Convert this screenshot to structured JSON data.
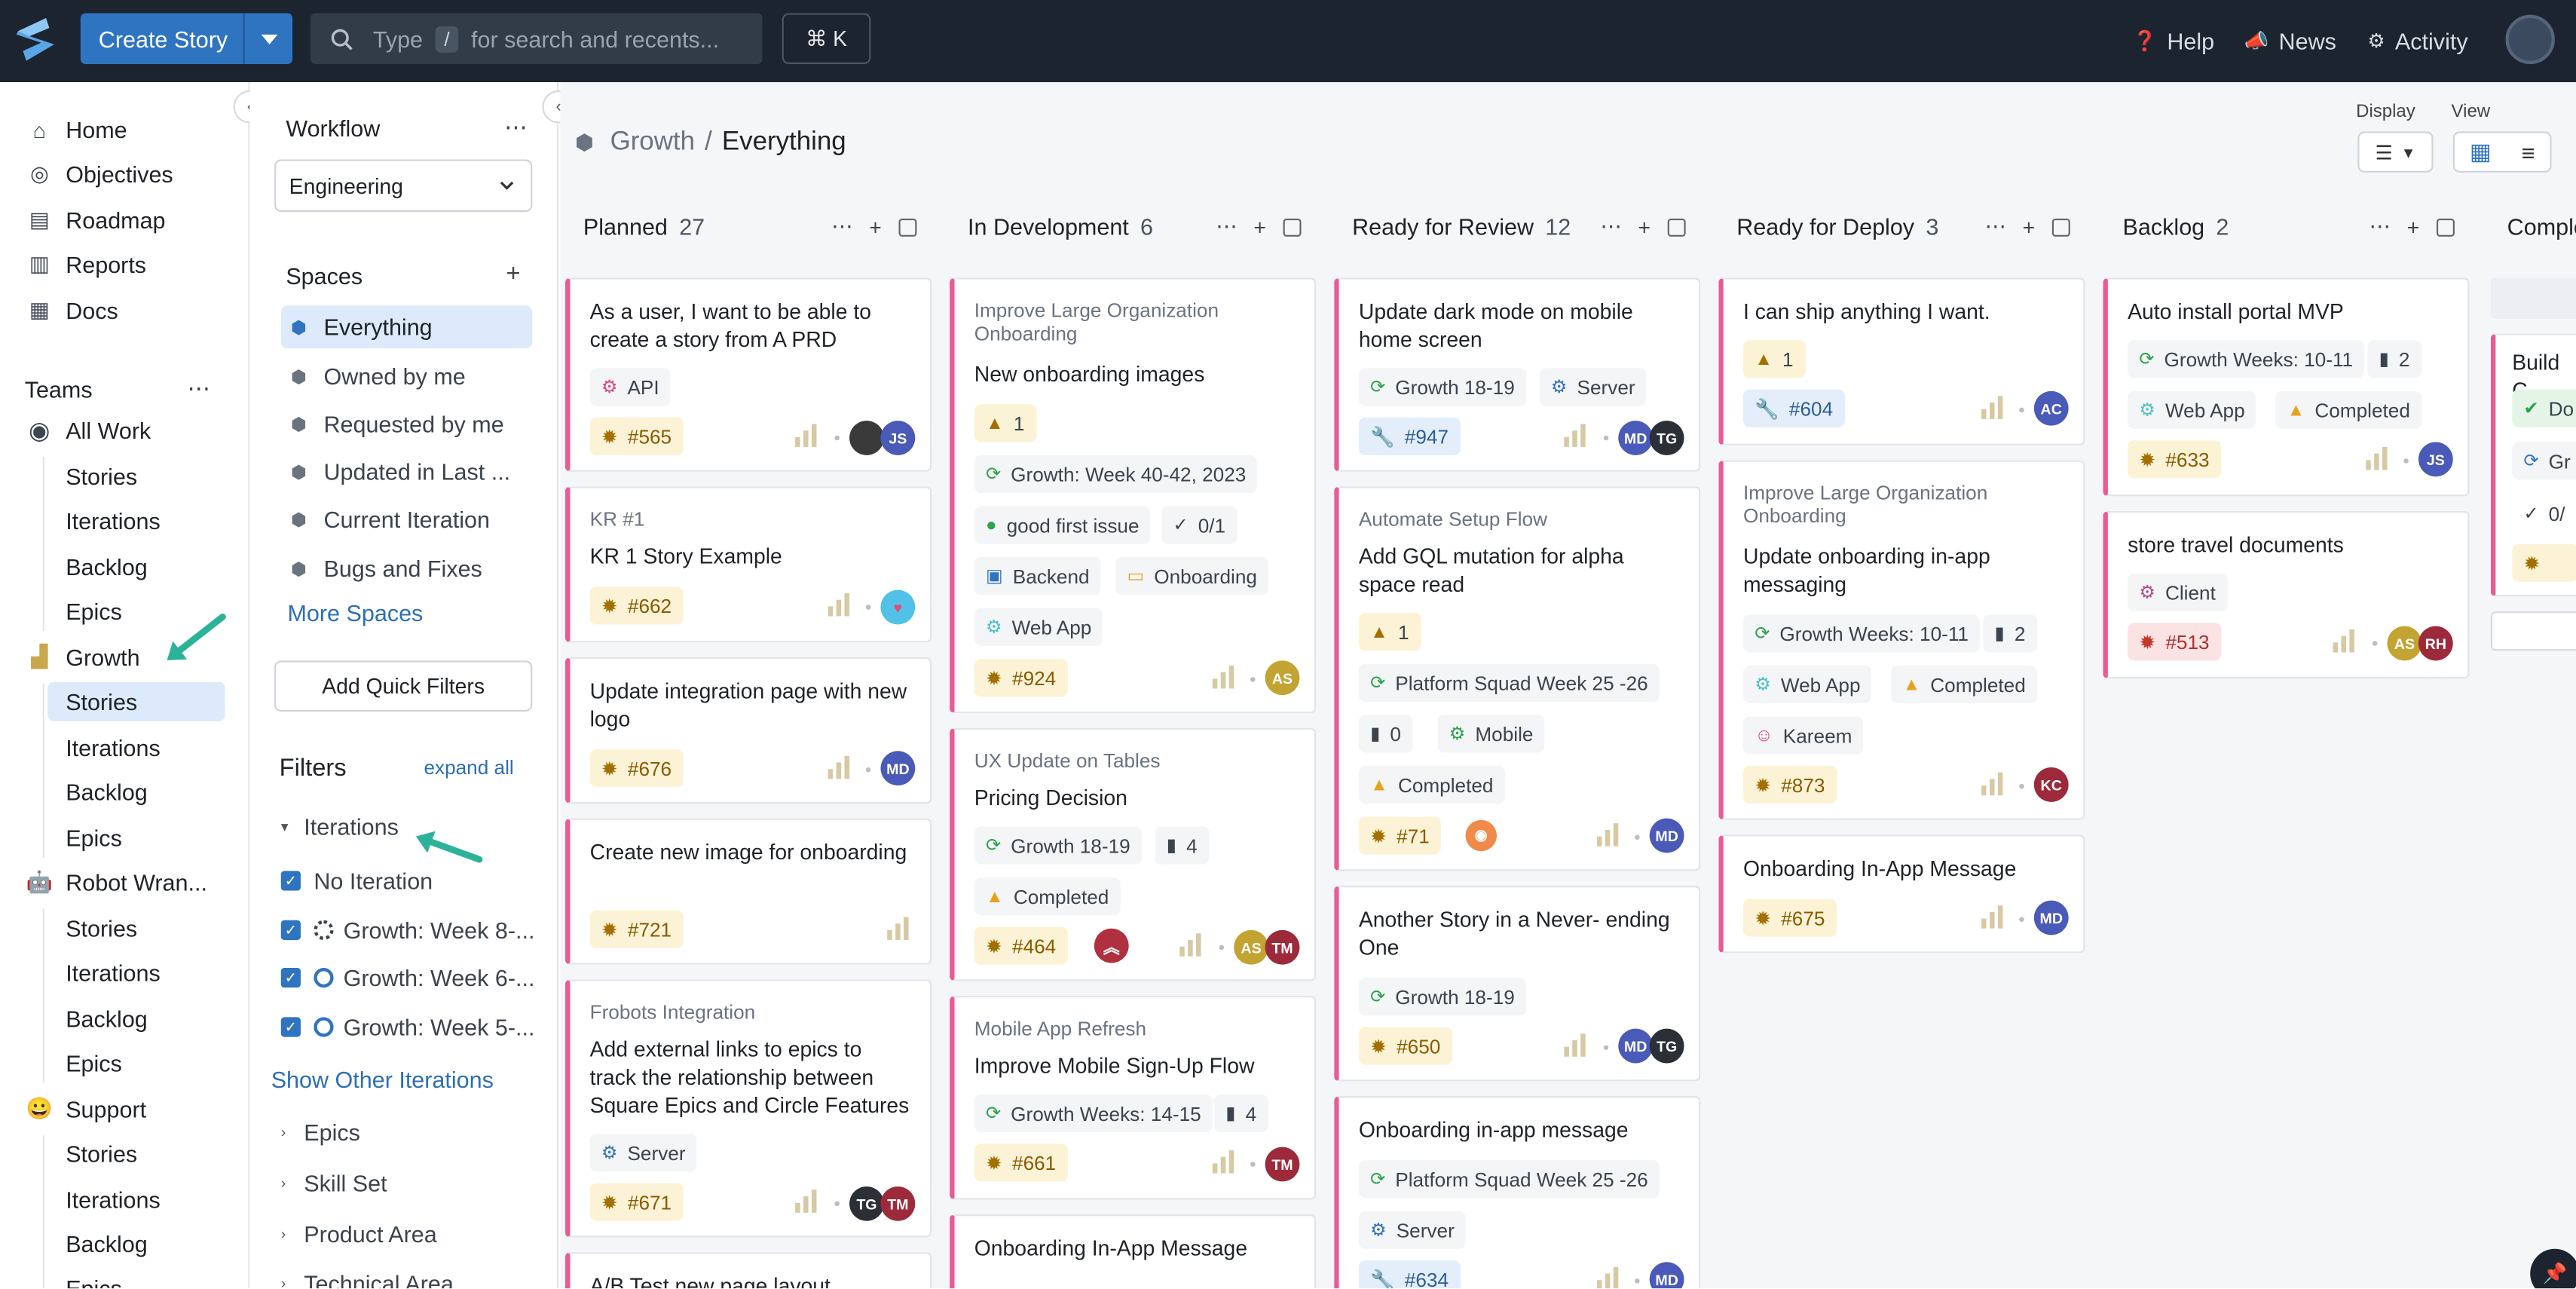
{
  "topbar": {
    "create_story": "Create Story",
    "search_placeholder": "Type",
    "search_key": "/",
    "search_suffix": "for search and recents...",
    "cmdk": "⌘ K",
    "help": "Help",
    "news": "News",
    "activity": "Activity"
  },
  "nav": {
    "home": "Home",
    "objectives": "Objectives",
    "roadmap": "Roadmap",
    "reports": "Reports",
    "docs": "Docs",
    "teams": "Teams",
    "all_work": "All Work",
    "stories": "Stories",
    "iterations": "Iterations",
    "backlog": "Backlog",
    "epics": "Epics",
    "growth": "Growth",
    "robot": "Robot Wran...",
    "support": "Support"
  },
  "workflow": {
    "title": "Workflow",
    "value": "Engineering"
  },
  "spaces": {
    "title": "Spaces",
    "items": [
      "Everything",
      "Owned by me",
      "Requested by me",
      "Updated in Last ...",
      "Current Iteration",
      "Bugs and Fixes"
    ],
    "more": "More Spaces",
    "quick": "Add Quick Filters"
  },
  "filters": {
    "title": "Filters",
    "expand": "expand all",
    "iterations": "Iterations",
    "opts": [
      "No Iteration",
      "Growth: Week 8-...",
      "Growth: Week 6-...",
      "Growth: Week 5-..."
    ],
    "show_other": "Show Other Iterations",
    "groups": [
      "Epics",
      "Skill Set",
      "Product Area",
      "Technical Area"
    ]
  },
  "breadcrumb": {
    "parent": "Growth",
    "sep": "/",
    "current": "Everything"
  },
  "display": {
    "display": "Display",
    "view": "View"
  },
  "columns": [
    {
      "name": "Planned",
      "count": "27"
    },
    {
      "name": "In Development",
      "count": "6"
    },
    {
      "name": "Ready for Review",
      "count": "12"
    },
    {
      "name": "Ready for Deploy",
      "count": "3"
    },
    {
      "name": "Backlog",
      "count": "2"
    },
    {
      "name": "Comple"
    }
  ],
  "cards": {
    "c1": {
      "title": "As a user, I want to be able to create a story from A PRD",
      "tag": "API",
      "num": "#565",
      "av2": "JS"
    },
    "c2": {
      "epic": "KR #1",
      "title": "KR 1 Story Example",
      "num": "#662"
    },
    "c3": {
      "title": "Update integration page with new logo",
      "num": "#676",
      "av": "MD"
    },
    "c4": {
      "title": "Create new image for onboarding",
      "num": "#721"
    },
    "c5": {
      "epic": "Frobots Integration",
      "title": "Add external links to epics to track the relationship between Square Epics and Circle Features",
      "tag": "Server",
      "num": "#671",
      "av1": "TG",
      "av2": "TM"
    },
    "c6": {
      "title": "A/B Test new page layout"
    },
    "d1": {
      "epic": "Improve Large Organization Onboarding",
      "title": "New onboarding images",
      "prio": "1",
      "iter": "Growth: Week 40-42, 2023",
      "label": "good first issue",
      "check": "0/1",
      "t1": "Backend",
      "t2": "Onboarding",
      "t3": "Web App",
      "num": "#924",
      "av": "AS"
    },
    "d2": {
      "epic": "UX Update on Tables",
      "title": "Pricing Decision",
      "iter": "Growth 18-19",
      "est": "4",
      "state": "Completed",
      "num": "#464",
      "av1": "AS",
      "av2": "TM"
    },
    "d3": {
      "epic": "Mobile App Refresh",
      "title": "Improve Mobile Sign-Up Flow",
      "iter": "Growth Weeks: 14-15",
      "est": "4",
      "num": "#661",
      "av": "TM"
    },
    "d4": {
      "title": "Onboarding In-App Message"
    },
    "r1": {
      "title": "Update dark mode on mobile home screen",
      "iter": "Growth 18-19",
      "tag": "Server",
      "num": "#947",
      "av1": "MD",
      "av2": "TG"
    },
    "r2": {
      "epic": "Automate Setup Flow",
      "title": "Add GQL mutation for alpha space read",
      "prio": "1",
      "iter": "Platform Squad Week 25 -26",
      "est": "0",
      "tag": "Mobile",
      "state": "Completed",
      "num": "#71",
      "av": "MD"
    },
    "r3": {
      "title": "Another Story in a Never- ending One",
      "iter": "Growth 18-19",
      "num": "#650",
      "av1": "MD",
      "av2": "TG"
    },
    "r4": {
      "title": "Onboarding in-app message",
      "iter": "Platform Squad Week 25 -26",
      "tag": "Server",
      "num": "#634",
      "av": "MD"
    },
    "p1": {
      "title": "I can ship anything I want.",
      "prio": "1",
      "num": "#604",
      "av": "AC"
    },
    "p2": {
      "epic": "Improve Large Organization Onboarding",
      "title": "Update onboarding in-app messaging",
      "iter": "Growth Weeks: 10-11",
      "est": "2",
      "t1": "Web App",
      "state": "Completed",
      "owner": "Kareem",
      "num": "#873",
      "av": "KC"
    },
    "p3": {
      "title": "Onboarding In-App Message",
      "num": "#675",
      "av": "MD"
    },
    "b1": {
      "title": "Auto install portal MVP",
      "iter": "Growth Weeks: 10-11",
      "est": "2",
      "t1": "Web App",
      "state": "Completed",
      "num": "#633",
      "av": "JS"
    },
    "b2": {
      "title": "store travel documents",
      "tag": "Client",
      "num": "#513",
      "av1": "AS",
      "av2": "RH"
    },
    "e1": {
      "title": "Build C",
      "tag1": "Do",
      "tag2": "Gr",
      "check": "0/"
    }
  }
}
